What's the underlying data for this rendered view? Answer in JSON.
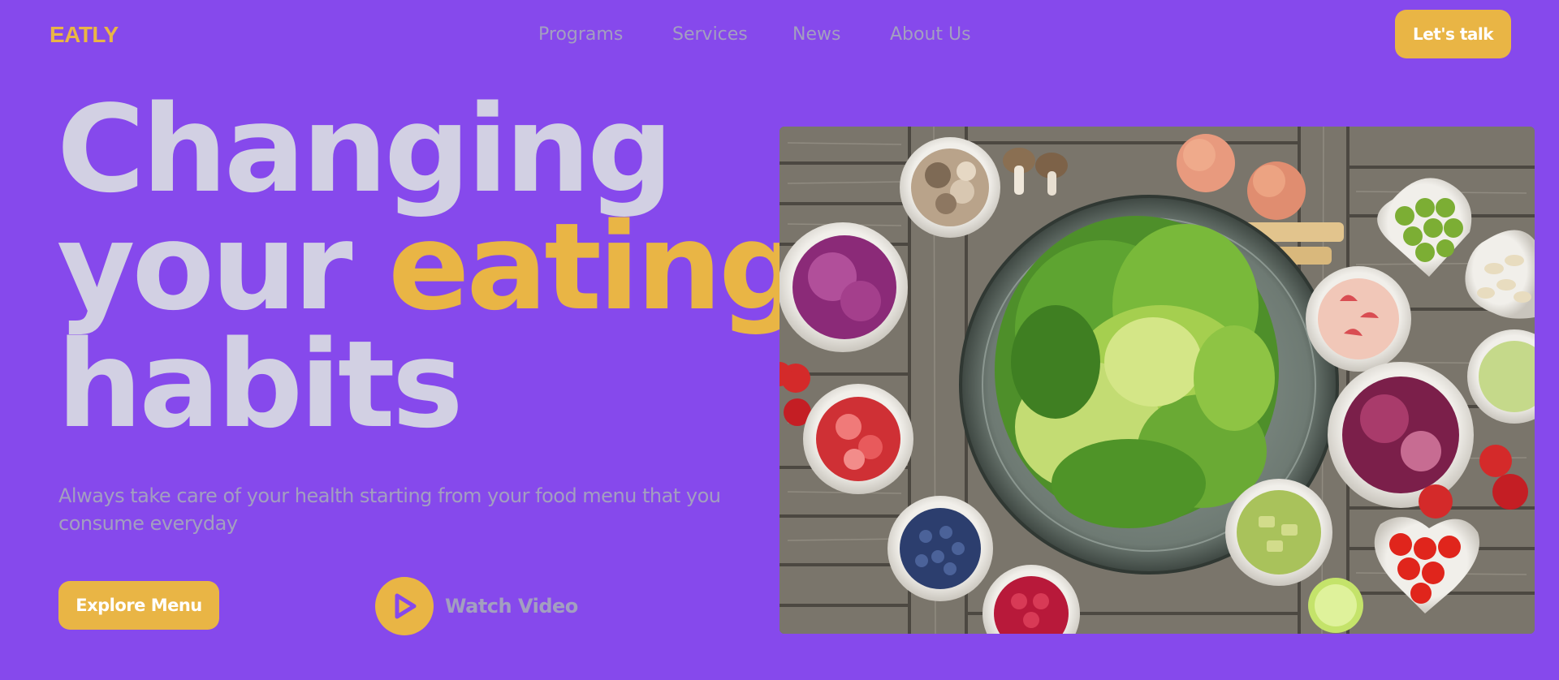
{
  "brand": {
    "name": "EATLY"
  },
  "nav": {
    "items": [
      {
        "label": "Programs"
      },
      {
        "label": "Services"
      },
      {
        "label": "News"
      },
      {
        "label": "About Us"
      }
    ],
    "cta_label": "Let's talk"
  },
  "hero": {
    "headline_line1": "Changing",
    "headline_line2_a": "your ",
    "headline_line2_b": "eating",
    "headline_line3": "habits",
    "subtitle": "Always take care of your health starting from your food menu that you consume everyday",
    "primary_button": "Explore Menu",
    "secondary_button": "Watch Video",
    "image_icon": "salad-table-photo"
  },
  "colors": {
    "background": "#8649ec",
    "accent": "#e9b545",
    "headline": "#d2d0e3",
    "muted_text": "#a39fc0"
  }
}
